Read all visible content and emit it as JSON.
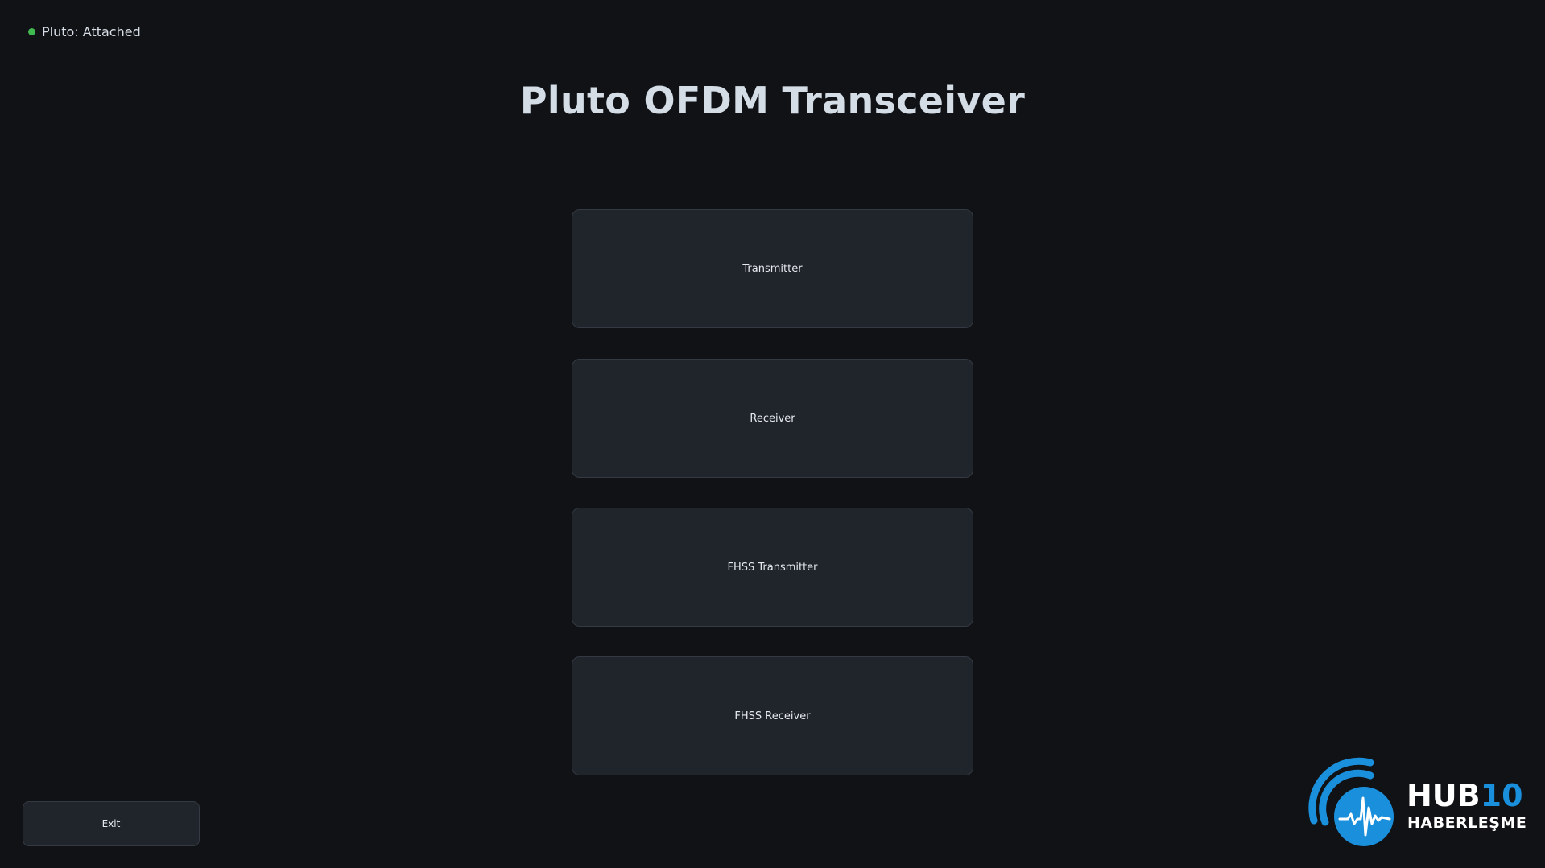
{
  "status": {
    "label": "Pluto: Attached",
    "color": "#3fb950"
  },
  "title": "Pluto OFDM Transceiver",
  "menu": {
    "transmitter": "Transmitter",
    "receiver": "Receiver",
    "fhss_transmitter": "FHSS Transmitter",
    "fhss_receiver": "FHSS Receiver"
  },
  "exit_label": "Exit",
  "logo": {
    "hub": "HUB",
    "ten": "10",
    "subtitle": "HABERLEŞME",
    "accent": "#1a8fdc"
  }
}
